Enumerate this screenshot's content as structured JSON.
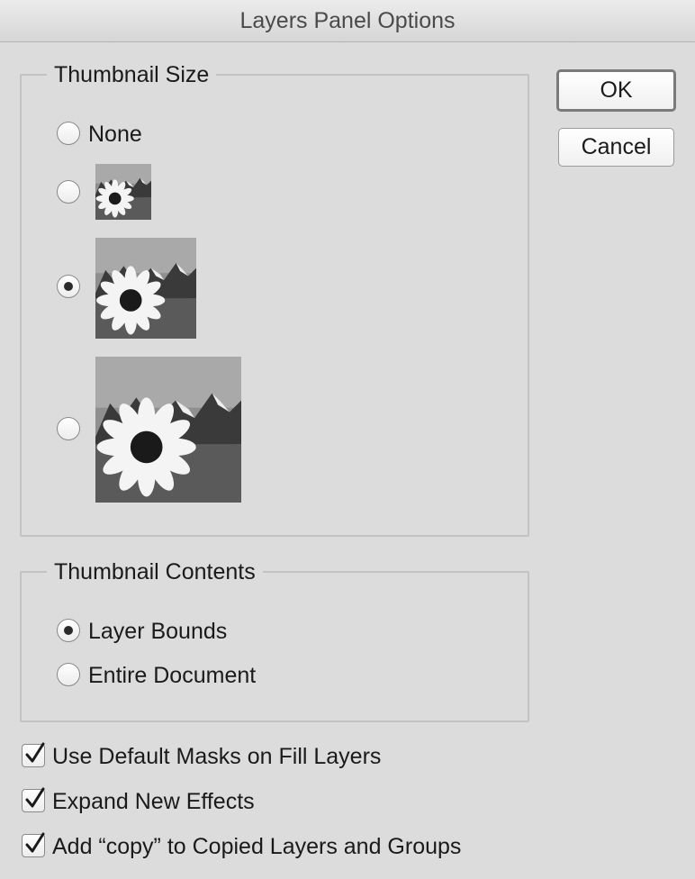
{
  "window": {
    "title": "Layers Panel Options"
  },
  "thumbnail_size": {
    "legend": "Thumbnail Size",
    "options": [
      {
        "label": "None",
        "selected": false
      },
      {
        "label": "",
        "size": "small",
        "selected": false
      },
      {
        "label": "",
        "size": "medium",
        "selected": true
      },
      {
        "label": "",
        "size": "large",
        "selected": false
      }
    ]
  },
  "thumbnail_contents": {
    "legend": "Thumbnail Contents",
    "options": [
      {
        "label": "Layer Bounds",
        "selected": true
      },
      {
        "label": "Entire Document",
        "selected": false
      }
    ]
  },
  "checkboxes": [
    {
      "label": "Use Default Masks on Fill Layers",
      "checked": true
    },
    {
      "label": "Expand New Effects",
      "checked": true
    },
    {
      "label": "Add “copy” to Copied Layers and Groups",
      "checked": true
    }
  ],
  "buttons": {
    "ok": "OK",
    "cancel": "Cancel"
  },
  "icons": {
    "thumbnail_image": "sunflower-thumbnail-icon",
    "check": "checkmark-icon"
  }
}
